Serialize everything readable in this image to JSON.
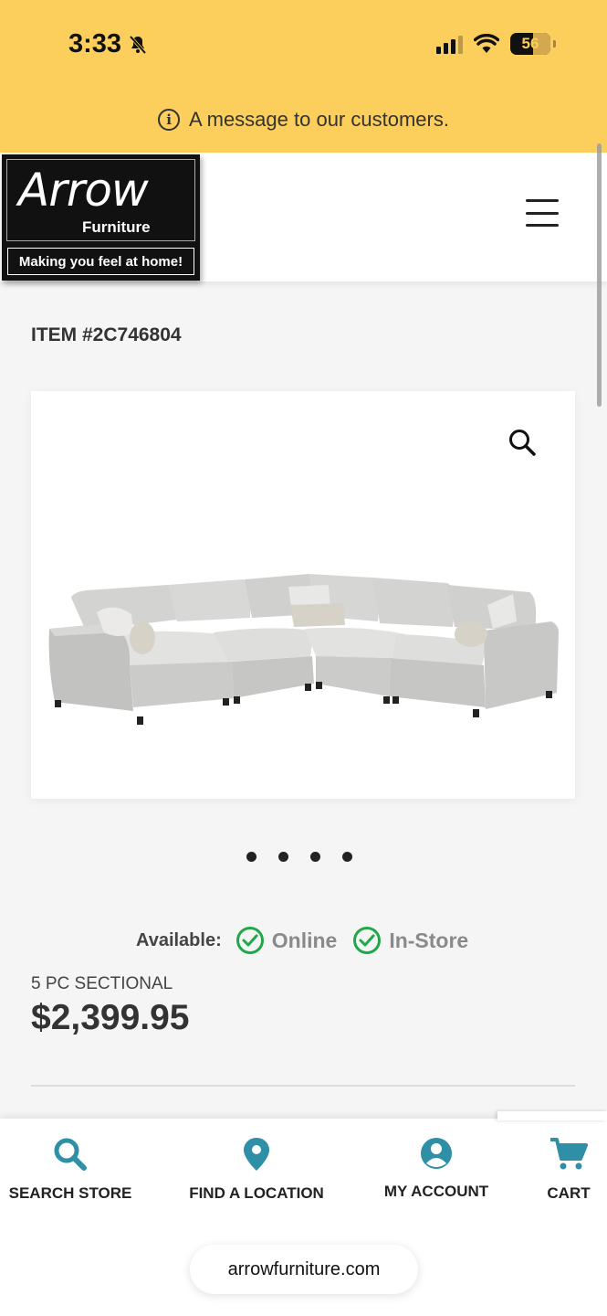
{
  "status_bar": {
    "time": "3:33",
    "battery": "56"
  },
  "announcement": {
    "text": "A message to our customers."
  },
  "logo": {
    "brand": "Arrow",
    "sub": "Furniture",
    "tagline": "Making you feel at home!"
  },
  "product": {
    "item_number": "ITEM #2C746804",
    "availability_label": "Available:",
    "availability": [
      "Online",
      "In-Store"
    ],
    "name": "5 PC SECTIONAL",
    "price": "$2,399.95",
    "image_count": 4
  },
  "bottom_nav": {
    "search": "SEARCH STORE",
    "location": "FIND A LOCATION",
    "account": "MY ACCOUNT",
    "cart": "CART"
  },
  "browser": {
    "url": "arrowfurniture.com"
  },
  "colors": {
    "announce_bg": "#fcce5b",
    "nav_icon": "#2e8fa6",
    "check": "#1fa84a"
  },
  "icons": [
    "bell-slash-icon",
    "signal-icon",
    "wifi-icon",
    "battery-icon",
    "info-icon",
    "menu-icon",
    "search-icon",
    "map-pin-icon",
    "user-icon",
    "cart-icon",
    "check-icon"
  ]
}
